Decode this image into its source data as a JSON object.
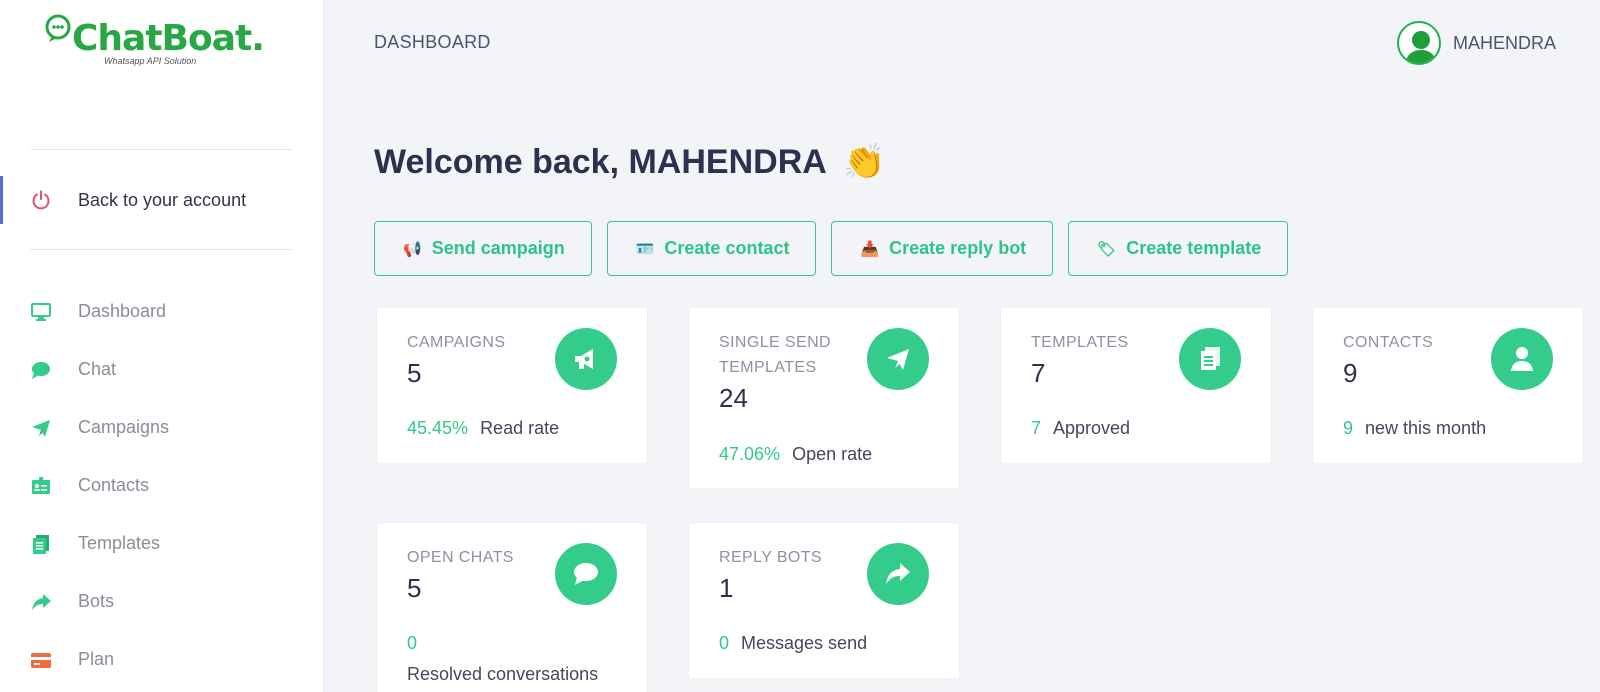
{
  "brand": {
    "name": "ChatBoat.",
    "tagline": "Whatsapp API Solution",
    "color": "#27a844"
  },
  "sidebar": {
    "back_item": {
      "label": "Back to your account",
      "icon": "power-icon"
    },
    "items": [
      {
        "label": "Dashboard",
        "icon": "monitor-icon"
      },
      {
        "label": "Chat",
        "icon": "chat-bubble-icon"
      },
      {
        "label": "Campaigns",
        "icon": "paper-plane-icon"
      },
      {
        "label": "Contacts",
        "icon": "id-card-icon"
      },
      {
        "label": "Templates",
        "icon": "document-icon"
      },
      {
        "label": "Bots",
        "icon": "share-arrow-icon"
      },
      {
        "label": "Plan",
        "icon": "credit-card-icon"
      }
    ]
  },
  "header": {
    "title": "DASHBOARD",
    "user_name": "MAHENDRA"
  },
  "welcome": {
    "text": "Welcome back, MAHENDRA",
    "emoji": "👏"
  },
  "actions": [
    {
      "label": "Send campaign",
      "emoji": "📢"
    },
    {
      "label": "Create contact",
      "emoji": "🪪"
    },
    {
      "label": "Create reply bot",
      "emoji": "📥"
    },
    {
      "label": "Create template",
      "emoji": "🏷"
    }
  ],
  "cards": {
    "campaigns": {
      "title": "CAMPAIGNS",
      "count": "5",
      "stat_value": "45.45%",
      "stat_label": "Read rate",
      "icon": "megaphone-icon"
    },
    "single_send": {
      "title": "SINGLE SEND TEMPLATES",
      "count": "24",
      "stat_value": "47.06%",
      "stat_label": "Open rate",
      "icon": "paper-plane-icon"
    },
    "templates": {
      "title": "TEMPLATES",
      "count": "7",
      "stat_value": "7",
      "stat_label": "Approved",
      "icon": "document-icon"
    },
    "contacts": {
      "title": "CONTACTS",
      "count": "9",
      "stat_value": "9",
      "stat_label": "new this month",
      "icon": "user-icon"
    },
    "open_chats": {
      "title": "OPEN CHATS",
      "count": "5",
      "stat_value": "0",
      "stat_label": "Resolved conversations",
      "icon": "chat-bubble-icon"
    },
    "reply_bots": {
      "title": "REPLY BOTS",
      "count": "1",
      "stat_value": "0",
      "stat_label": "Messages send",
      "icon": "share-arrow-icon"
    }
  },
  "colors": {
    "accent": "#33cc8a",
    "accent_text": "#2bc585",
    "active_bar": "#5b6bd8",
    "plan_icon": "#ef6a3f",
    "back_icon": "#e2536e"
  }
}
